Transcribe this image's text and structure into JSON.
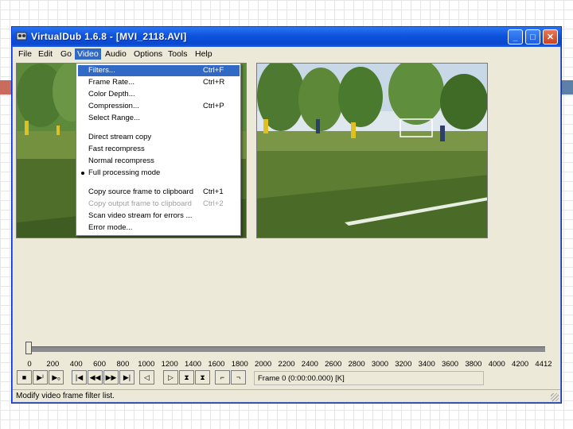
{
  "window": {
    "title": "VirtualDub 1.6.8 - [MVI_2118.AVI]",
    "minimize_glyph": "_",
    "maximize_glyph": "□",
    "close_glyph": "✕"
  },
  "menubar": {
    "items": [
      "File",
      "Edit",
      "Go",
      "Video",
      "Audio",
      "Options",
      "Tools",
      "Help"
    ],
    "active": "Video"
  },
  "video_menu": {
    "items": [
      {
        "label": "Filters...",
        "shortcut": "Ctrl+F",
        "highlighted": true
      },
      {
        "label": "Frame Rate...",
        "shortcut": "Ctrl+R"
      },
      {
        "label": "Color Depth...",
        "shortcut": ""
      },
      {
        "label": "Compression...",
        "shortcut": "Ctrl+P"
      },
      {
        "label": "Select Range...",
        "shortcut": ""
      },
      {
        "label": "Direct stream copy",
        "shortcut": ""
      },
      {
        "label": "Fast recompress",
        "shortcut": ""
      },
      {
        "label": "Normal recompress",
        "shortcut": ""
      },
      {
        "label": "Full processing mode",
        "shortcut": "",
        "checked": true
      },
      {
        "label": "Copy source frame to clipboard",
        "shortcut": "Ctrl+1"
      },
      {
        "label": "Copy output frame to clipboard",
        "shortcut": "Ctrl+2",
        "disabled": true
      },
      {
        "label": "Scan video stream for errors ...",
        "shortcut": ""
      },
      {
        "label": "Error mode...",
        "shortcut": ""
      }
    ]
  },
  "timeline": {
    "ticks": [
      "0",
      "200",
      "400",
      "600",
      "800",
      "1000",
      "1200",
      "1400",
      "1600",
      "1800",
      "2000",
      "2200",
      "2400",
      "2600",
      "2800",
      "3000",
      "3200",
      "3400",
      "3600",
      "3800",
      "4000",
      "4200",
      "4412"
    ],
    "position_fraction": 0
  },
  "toolbar": {
    "buttons": [
      {
        "name": "stop-button",
        "icon": "stop-icon",
        "glyph": "■"
      },
      {
        "name": "play-input-button",
        "icon": "play-input-icon",
        "glyph": "▶ᴵ"
      },
      {
        "name": "play-output-button",
        "icon": "play-output-icon",
        "glyph": "▶ₒ"
      },
      {
        "name": "go-start-button",
        "icon": "go-start-icon",
        "glyph": "|◀"
      },
      {
        "name": "step-back-button",
        "icon": "step-back-icon",
        "glyph": "◀◀"
      },
      {
        "name": "step-forward-button",
        "icon": "step-forward-icon",
        "glyph": "▶▶"
      },
      {
        "name": "go-end-button",
        "icon": "go-end-icon",
        "glyph": "▶|"
      },
      {
        "name": "prev-key-button",
        "icon": "prev-keyframe-icon",
        "glyph": "◁"
      },
      {
        "name": "next-key-button",
        "icon": "next-keyframe-icon",
        "glyph": "▷"
      },
      {
        "name": "scene-back-button",
        "icon": "scene-back-icon",
        "glyph": "⧗"
      },
      {
        "name": "scene-forward-button",
        "icon": "scene-forward-icon",
        "glyph": "⧗"
      },
      {
        "name": "mark-in-button",
        "icon": "mark-in-icon",
        "glyph": "⌐"
      },
      {
        "name": "mark-out-button",
        "icon": "mark-out-icon",
        "glyph": "¬"
      }
    ],
    "frame_info": "Frame 0 (0:00:00.000) [K]"
  },
  "status": {
    "text": "Modify video frame filter list."
  },
  "colors": {
    "titlebar": "#0a48cf",
    "menu_highlight": "#316ac5",
    "window_bg": "#ece9d8"
  }
}
